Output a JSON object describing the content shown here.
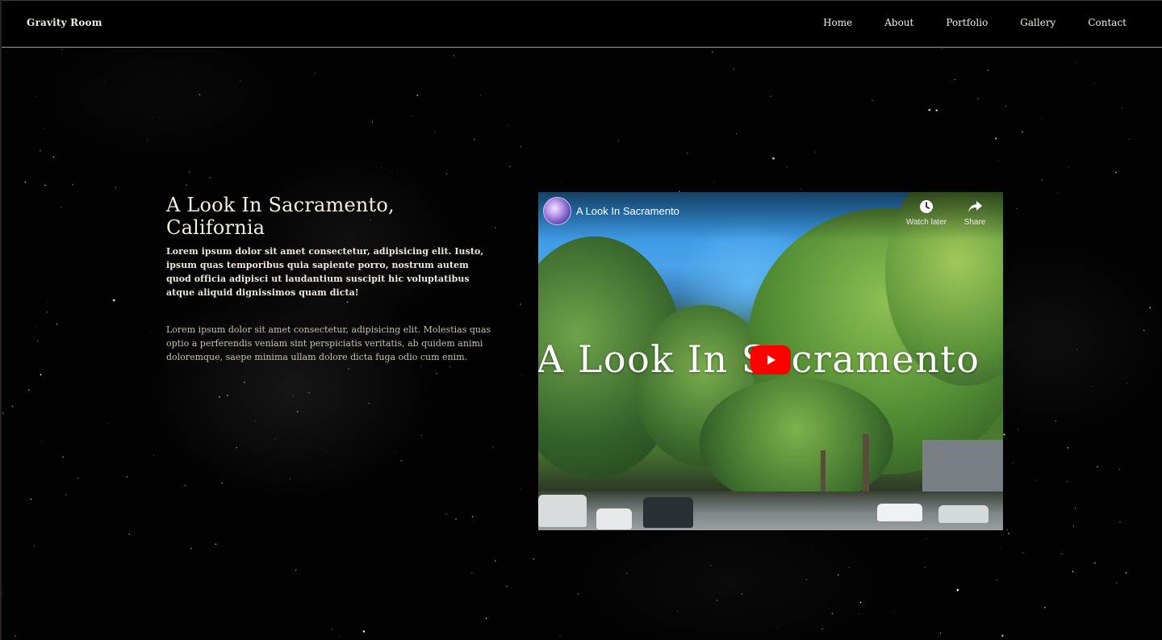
{
  "header": {
    "brand": "Gravity Room",
    "nav": [
      "Home",
      "About",
      "Portfolio",
      "Gallery",
      "Contact"
    ]
  },
  "section": {
    "title": "A Look In Sacramento, California",
    "paragraph1": "Lorem ipsum dolor sit amet consectetur, adipisicing elit. Iusto, ipsum quas temporibus quia sapiente porro, nostrum autem quod officia adipisci ut laudantium suscipit hic voluptatibus atque aliquid dignissimos quam dicta!",
    "paragraph2": "Lorem ipsum dolor sit amet consectetur, adipisicing elit. Molestias quas optio a perferendis veniam sint perspiciatis veritatis, ab quidem animi doloremque, saepe minima ullam dolore dicta fuga odio cum enim."
  },
  "video": {
    "channel_title": "A Look In Sacramento",
    "watch_later_label": "Watch later",
    "share_label": "Share",
    "overlay_text": "A Look In Sacramento",
    "play_icon": "youtube-play-icon",
    "accent_color": "#ff0000"
  },
  "colors": {
    "background": "#000000",
    "text_primary": "#f2ede4",
    "text_secondary": "#c9c1b2"
  }
}
